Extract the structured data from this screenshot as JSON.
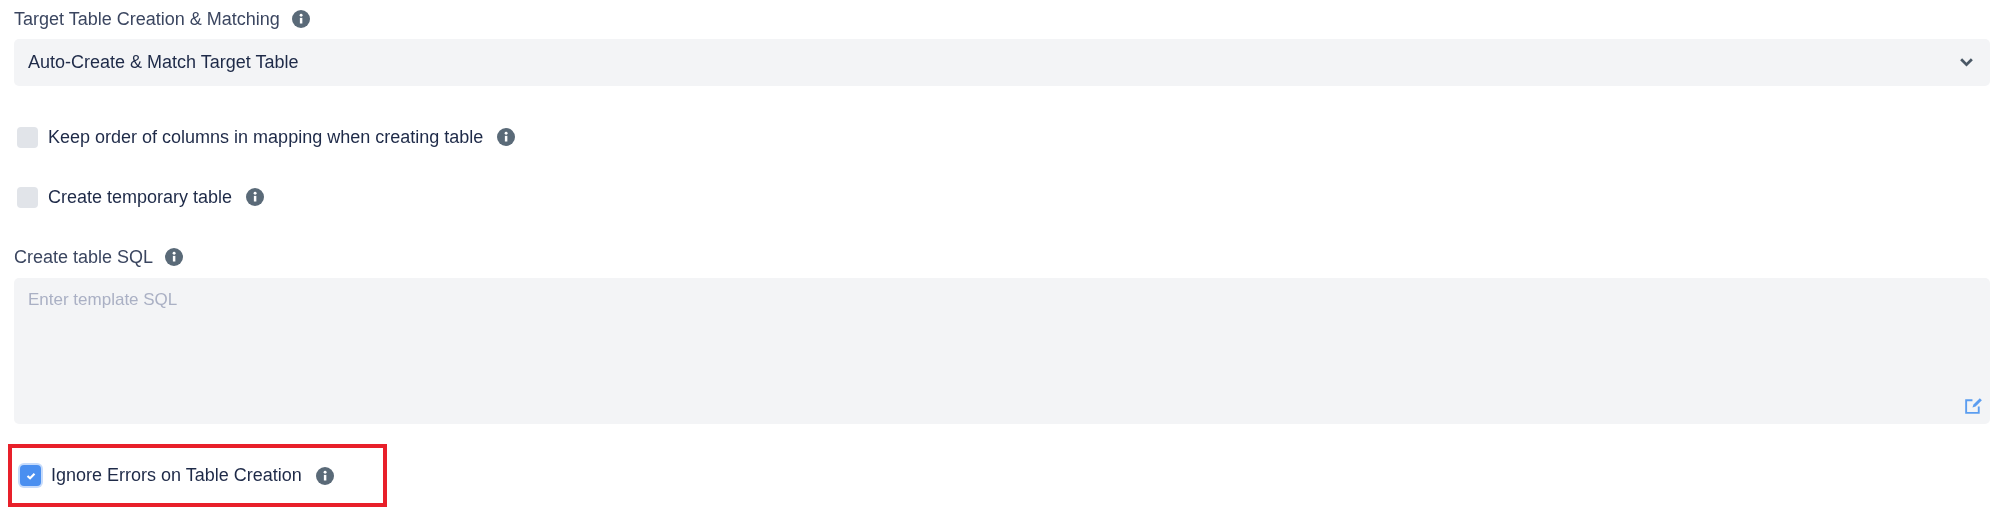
{
  "matching": {
    "label": "Target Table Creation & Matching",
    "value": "Auto-Create & Match Target Table"
  },
  "options_top": [
    {
      "label": "Keep order of columns in mapping when creating table",
      "checked": false
    },
    {
      "label": "Create temporary table",
      "checked": false
    }
  ],
  "sql": {
    "label": "Create table SQL",
    "placeholder": "Enter template SQL"
  },
  "options_bottom": [
    {
      "label": "Ignore Errors on Table Creation",
      "checked": true,
      "highlighted": true
    }
  ]
}
